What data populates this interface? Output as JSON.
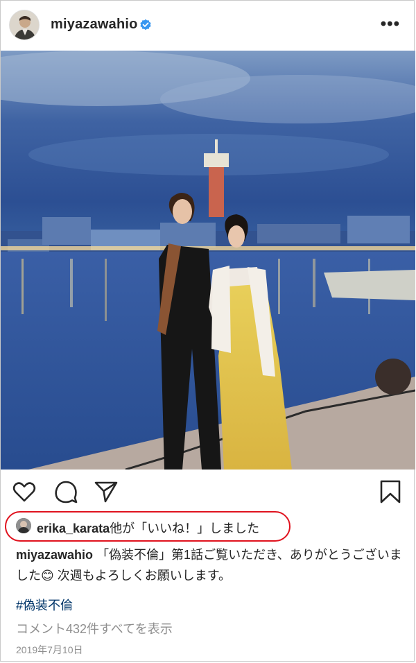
{
  "post": {
    "username": "miyazawahio",
    "verified_icon": "verified-badge-icon",
    "more_icon": "more-options-icon",
    "more_glyph": "•••"
  },
  "actions": {
    "like_icon": "heart-icon",
    "comment_icon": "comment-icon",
    "share_icon": "send-icon",
    "save_icon": "bookmark-icon"
  },
  "likes": {
    "user": "erika_karata",
    "suffix": "他が「いいね！」しました"
  },
  "caption": {
    "user": "miyazawahio",
    "text_before_emoji": "「偽装不倫」第1話ご覧いただき、ありがとうございました",
    "emoji": "😊",
    "text_after_emoji": " 次週もよろしくお願いします。"
  },
  "hashtag": "#偽装不倫",
  "comments_link": "コメント432件すべてを表示",
  "date": "2019年7月10日",
  "colors": {
    "text": "#262626",
    "muted": "#8e8e8e",
    "link": "#003569",
    "verified": "#3897f0",
    "highlight": "#e0121e"
  }
}
